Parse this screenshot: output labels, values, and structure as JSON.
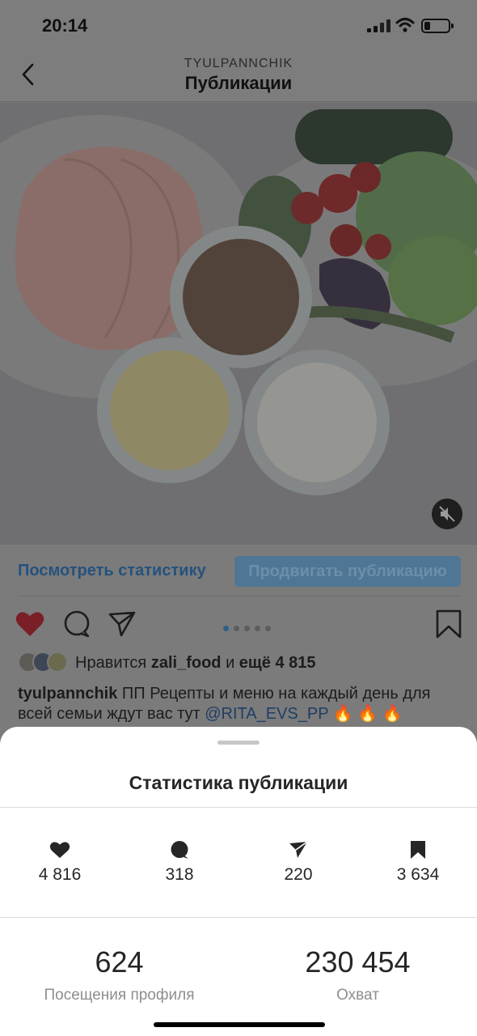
{
  "status_bar": {
    "time": "20:14"
  },
  "nav": {
    "account": "TYULPANNCHIK",
    "title": "Публикации"
  },
  "post": {
    "carousel": {
      "count": 5,
      "active": 0
    },
    "view_insights": "Посмотреть статистику",
    "promote": "Продвигать публикацию",
    "likes": {
      "prefix": "Нравится",
      "user": "zali_food",
      "middle": "и",
      "more": "ещё 4 815"
    },
    "caption": {
      "username": "tyulpannchik",
      "text": "ПП Рецепты и меню на каждый день для всей семьи ждут вас тут",
      "mention": "@RITA_EVS_PP",
      "emoji": "🔥 🔥 🔥"
    }
  },
  "insights_sheet": {
    "title": "Статистика публикации",
    "metrics": [
      {
        "icon": "heart-icon",
        "value": "4 816"
      },
      {
        "icon": "comment-icon",
        "value": "318"
      },
      {
        "icon": "share-icon",
        "value": "220"
      },
      {
        "icon": "bookmark-icon",
        "value": "3 634"
      }
    ],
    "profile_visits": {
      "value": "624",
      "label": "Посещения профиля"
    },
    "reach": {
      "value": "230 454",
      "label": "Охват"
    }
  },
  "colors": {
    "accent": "#3897f0",
    "like": "#ed4956",
    "dim_overlay": "rgba(0,0,0,0.5)"
  }
}
